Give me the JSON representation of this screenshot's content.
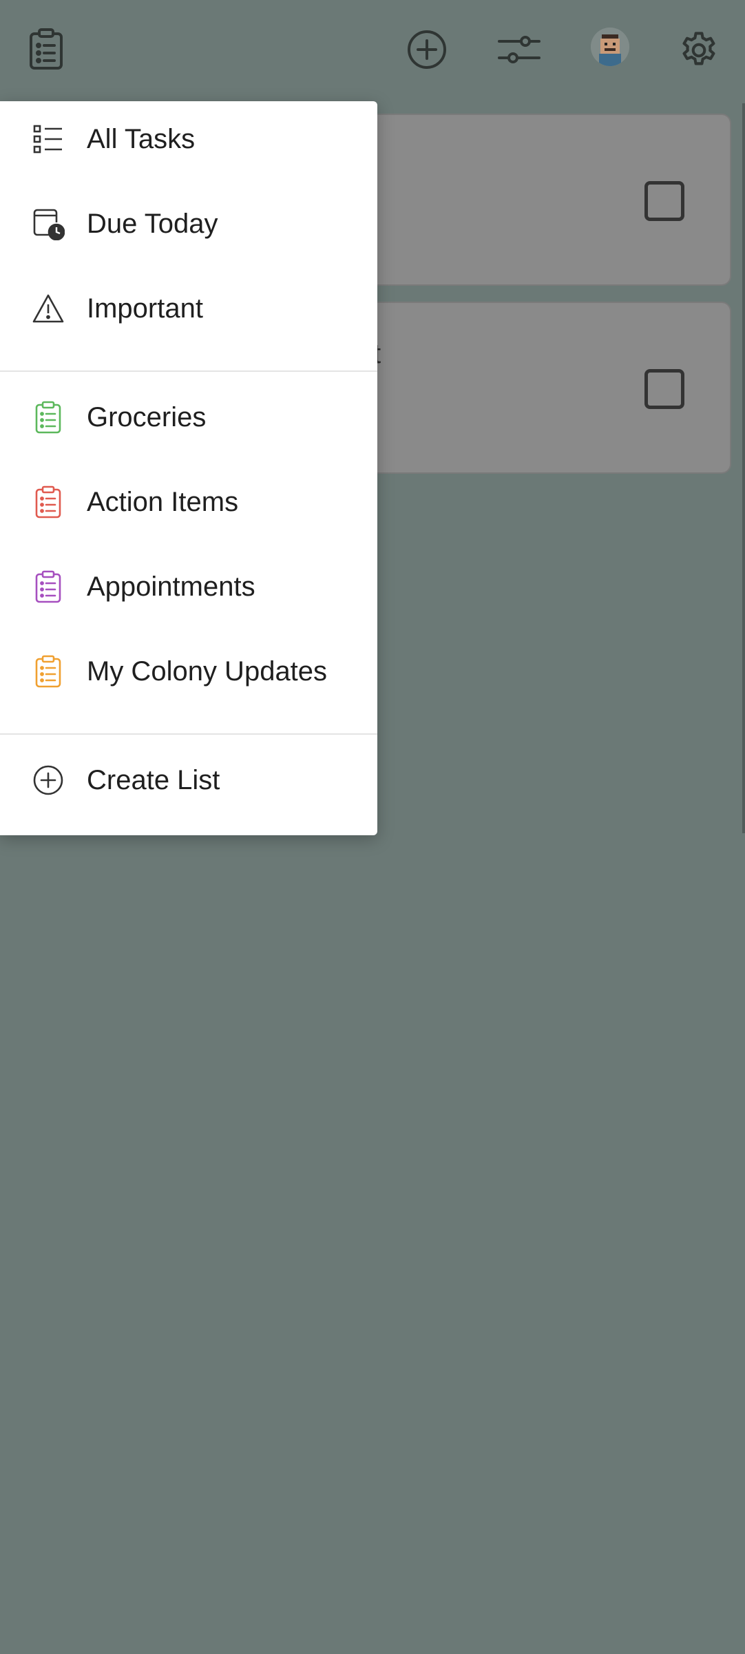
{
  "topbar": {
    "lists_icon": "clipboard-list-icon",
    "add_icon": "plus-circle-icon",
    "filter_icon": "sliders-icon",
    "avatar_icon": "user-avatar",
    "settings_icon": "gear-icon"
  },
  "background_tasks": [
    {
      "peek_text": "",
      "checked": false
    },
    {
      "peek_text": "t",
      "checked": false
    }
  ],
  "menu": {
    "smart_lists": [
      {
        "label": "All Tasks",
        "icon": "list-icon"
      },
      {
        "label": "Due Today",
        "icon": "calendar-clock-icon"
      },
      {
        "label": "Important",
        "icon": "warning-triangle-icon"
      }
    ],
    "user_lists": [
      {
        "label": "Groceries",
        "icon": "clipboard-list-icon",
        "color": "#5cb85c"
      },
      {
        "label": "Action Items",
        "icon": "clipboard-list-icon",
        "color": "#e05a4f"
      },
      {
        "label": "Appointments",
        "icon": "clipboard-list-icon",
        "color": "#a64fbf"
      },
      {
        "label": "My Colony Updates",
        "icon": "clipboard-list-icon",
        "color": "#f0a030"
      }
    ],
    "create": {
      "label": "Create List",
      "icon": "plus-circle-icon"
    }
  }
}
